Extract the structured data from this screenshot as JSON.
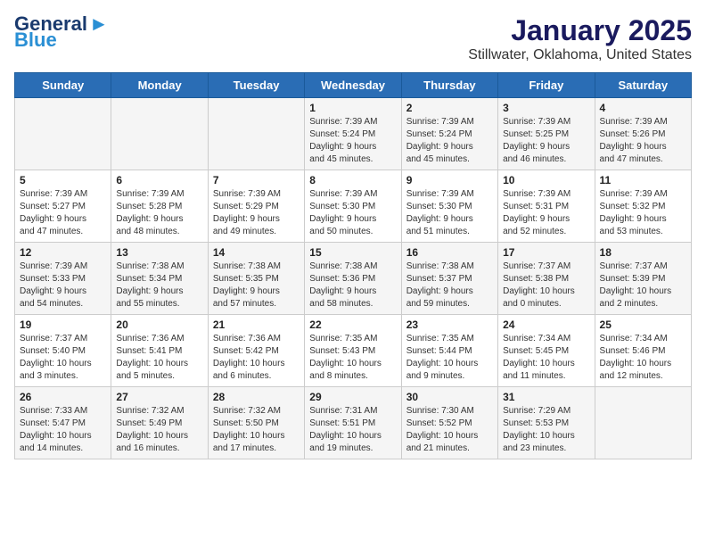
{
  "header": {
    "logo_line1": "General",
    "logo_line2": "Blue",
    "title": "January 2025",
    "subtitle": "Stillwater, Oklahoma, United States"
  },
  "weekdays": [
    "Sunday",
    "Monday",
    "Tuesday",
    "Wednesday",
    "Thursday",
    "Friday",
    "Saturday"
  ],
  "weeks": [
    [
      {
        "day": "",
        "content": ""
      },
      {
        "day": "",
        "content": ""
      },
      {
        "day": "",
        "content": ""
      },
      {
        "day": "1",
        "content": "Sunrise: 7:39 AM\nSunset: 5:24 PM\nDaylight: 9 hours\nand 45 minutes."
      },
      {
        "day": "2",
        "content": "Sunrise: 7:39 AM\nSunset: 5:24 PM\nDaylight: 9 hours\nand 45 minutes."
      },
      {
        "day": "3",
        "content": "Sunrise: 7:39 AM\nSunset: 5:25 PM\nDaylight: 9 hours\nand 46 minutes."
      },
      {
        "day": "4",
        "content": "Sunrise: 7:39 AM\nSunset: 5:26 PM\nDaylight: 9 hours\nand 47 minutes."
      }
    ],
    [
      {
        "day": "5",
        "content": "Sunrise: 7:39 AM\nSunset: 5:27 PM\nDaylight: 9 hours\nand 47 minutes."
      },
      {
        "day": "6",
        "content": "Sunrise: 7:39 AM\nSunset: 5:28 PM\nDaylight: 9 hours\nand 48 minutes."
      },
      {
        "day": "7",
        "content": "Sunrise: 7:39 AM\nSunset: 5:29 PM\nDaylight: 9 hours\nand 49 minutes."
      },
      {
        "day": "8",
        "content": "Sunrise: 7:39 AM\nSunset: 5:30 PM\nDaylight: 9 hours\nand 50 minutes."
      },
      {
        "day": "9",
        "content": "Sunrise: 7:39 AM\nSunset: 5:30 PM\nDaylight: 9 hours\nand 51 minutes."
      },
      {
        "day": "10",
        "content": "Sunrise: 7:39 AM\nSunset: 5:31 PM\nDaylight: 9 hours\nand 52 minutes."
      },
      {
        "day": "11",
        "content": "Sunrise: 7:39 AM\nSunset: 5:32 PM\nDaylight: 9 hours\nand 53 minutes."
      }
    ],
    [
      {
        "day": "12",
        "content": "Sunrise: 7:39 AM\nSunset: 5:33 PM\nDaylight: 9 hours\nand 54 minutes."
      },
      {
        "day": "13",
        "content": "Sunrise: 7:38 AM\nSunset: 5:34 PM\nDaylight: 9 hours\nand 55 minutes."
      },
      {
        "day": "14",
        "content": "Sunrise: 7:38 AM\nSunset: 5:35 PM\nDaylight: 9 hours\nand 57 minutes."
      },
      {
        "day": "15",
        "content": "Sunrise: 7:38 AM\nSunset: 5:36 PM\nDaylight: 9 hours\nand 58 minutes."
      },
      {
        "day": "16",
        "content": "Sunrise: 7:38 AM\nSunset: 5:37 PM\nDaylight: 9 hours\nand 59 minutes."
      },
      {
        "day": "17",
        "content": "Sunrise: 7:37 AM\nSunset: 5:38 PM\nDaylight: 10 hours\nand 0 minutes."
      },
      {
        "day": "18",
        "content": "Sunrise: 7:37 AM\nSunset: 5:39 PM\nDaylight: 10 hours\nand 2 minutes."
      }
    ],
    [
      {
        "day": "19",
        "content": "Sunrise: 7:37 AM\nSunset: 5:40 PM\nDaylight: 10 hours\nand 3 minutes."
      },
      {
        "day": "20",
        "content": "Sunrise: 7:36 AM\nSunset: 5:41 PM\nDaylight: 10 hours\nand 5 minutes."
      },
      {
        "day": "21",
        "content": "Sunrise: 7:36 AM\nSunset: 5:42 PM\nDaylight: 10 hours\nand 6 minutes."
      },
      {
        "day": "22",
        "content": "Sunrise: 7:35 AM\nSunset: 5:43 PM\nDaylight: 10 hours\nand 8 minutes."
      },
      {
        "day": "23",
        "content": "Sunrise: 7:35 AM\nSunset: 5:44 PM\nDaylight: 10 hours\nand 9 minutes."
      },
      {
        "day": "24",
        "content": "Sunrise: 7:34 AM\nSunset: 5:45 PM\nDaylight: 10 hours\nand 11 minutes."
      },
      {
        "day": "25",
        "content": "Sunrise: 7:34 AM\nSunset: 5:46 PM\nDaylight: 10 hours\nand 12 minutes."
      }
    ],
    [
      {
        "day": "26",
        "content": "Sunrise: 7:33 AM\nSunset: 5:47 PM\nDaylight: 10 hours\nand 14 minutes."
      },
      {
        "day": "27",
        "content": "Sunrise: 7:32 AM\nSunset: 5:49 PM\nDaylight: 10 hours\nand 16 minutes."
      },
      {
        "day": "28",
        "content": "Sunrise: 7:32 AM\nSunset: 5:50 PM\nDaylight: 10 hours\nand 17 minutes."
      },
      {
        "day": "29",
        "content": "Sunrise: 7:31 AM\nSunset: 5:51 PM\nDaylight: 10 hours\nand 19 minutes."
      },
      {
        "day": "30",
        "content": "Sunrise: 7:30 AM\nSunset: 5:52 PM\nDaylight: 10 hours\nand 21 minutes."
      },
      {
        "day": "31",
        "content": "Sunrise: 7:29 AM\nSunset: 5:53 PM\nDaylight: 10 hours\nand 23 minutes."
      },
      {
        "day": "",
        "content": ""
      }
    ]
  ]
}
